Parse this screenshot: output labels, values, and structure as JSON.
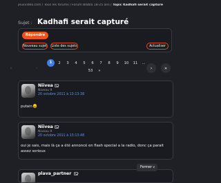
{
  "breadcrumb": {
    "prefix": "jeuxvideo.com / Tous les forums / Forum Blabla 18-25 ans / ",
    "current": "Topic Kadhafi serait capturé"
  },
  "topic": {
    "subject_label": "Sujet :",
    "title": "Kadhafi serait capturé"
  },
  "actions": {
    "reply": "Répondre",
    "new_topic": "Nouveau sujet",
    "topic_list": "Liste des sujets",
    "refresh": "Actualiser"
  },
  "pagination": {
    "first_icon": "double-chevron-left-icon",
    "prev_icon": "chevron-left-icon",
    "next_icon": "chevron-right-icon",
    "last_icon": "double-chevron-right-icon",
    "first": "«",
    "prev": "‹",
    "next": "›",
    "last": "»",
    "pages": [
      "1",
      "2",
      "3",
      "4",
      "5",
      "6",
      "7",
      "8",
      "9",
      "10",
      "11"
    ],
    "ellipsis": "...",
    "last_page": "53",
    "more": "»",
    "current_page": "1"
  },
  "posts": [
    {
      "author": "Niivea",
      "level": "Niveau 9",
      "date": "20 octobre 2011 à 13:13:38",
      "body": "putain",
      "emoji": "smiley-emoji"
    },
    {
      "author": "Niivea",
      "level": "Niveau 9",
      "date": "20 octobre 2011 à 13:13:48",
      "body": "oui je sais, mais là ça a été annoncé en flash special a la radio, donc ça parait assez serieux"
    },
    {
      "author": "plava_partner"
    }
  ],
  "close_button": {
    "label": "Fermer",
    "chevron": "v"
  },
  "colors": {
    "accent": "#f0531c",
    "link": "#5d94f5",
    "page_current": "#3f7fe6",
    "background": "#1f1f26"
  }
}
